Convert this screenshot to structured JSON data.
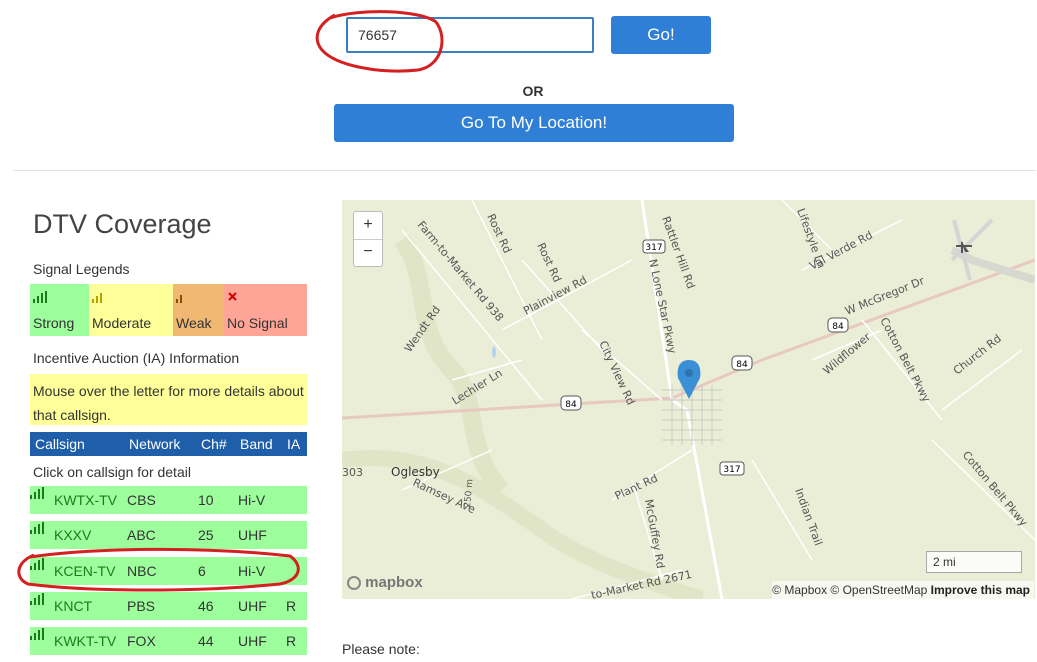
{
  "search": {
    "zip_value": "76657",
    "go_label": "Go!",
    "or_label": "OR",
    "locate_label": "Go To My Location!"
  },
  "panel": {
    "title": "DTV Coverage",
    "signal_legends_label": "Signal Legends",
    "legend": [
      {
        "label": "Strong",
        "color": "#9cff9c",
        "icon": "signal-strong-icon"
      },
      {
        "label": "Moderate",
        "color": "#ffff99",
        "icon": "signal-moderate-icon"
      },
      {
        "label": "Weak",
        "color": "#f0b873",
        "icon": "signal-weak-icon"
      },
      {
        "label": "No Signal",
        "color": "#ffa597",
        "icon": "no-signal-icon"
      }
    ],
    "ia_label": "Incentive Auction (IA) Information",
    "ia_text": "Mouse over the letter for more details about that callsign.",
    "table_headers": {
      "callsign": "Callsign",
      "network": "Network",
      "ch": "Ch#",
      "band": "Band",
      "ia": "IA"
    },
    "click_hint": "Click on callsign for detail",
    "rows": [
      {
        "callsign": "KWTX-TV",
        "network": "CBS",
        "ch": "10",
        "band": "Hi-V",
        "ia": ""
      },
      {
        "callsign": "KXXV",
        "network": "ABC",
        "ch": "25",
        "band": "UHF",
        "ia": ""
      },
      {
        "callsign": "KCEN-TV",
        "network": "NBC",
        "ch": "6",
        "band": "Hi-V",
        "ia": ""
      },
      {
        "callsign": "KNCT",
        "network": "PBS",
        "ch": "46",
        "band": "UHF",
        "ia": "R"
      },
      {
        "callsign": "KWKT-TV",
        "network": "FOX",
        "ch": "44",
        "band": "UHF",
        "ia": "R"
      }
    ]
  },
  "map": {
    "zoom_in": "+",
    "zoom_out": "−",
    "scale": "2 mi",
    "attribution": "© Mapbox © OpenStreetMap",
    "improve": "Improve this map",
    "logo": "mapbox",
    "labels": [
      "Rattler Hill Rd",
      "Lifestyle Ln",
      "Val Verde Rd",
      "Rost Rd",
      "Rost Rd",
      "Farm-to-Market Rd 938",
      "Plainview Rd",
      "N Lone Star Pkwy",
      "W McGregor Dr",
      "Wendt Rd",
      "City View Rd",
      "Wildflower",
      "Cotton Belt Pkwy",
      "Church Rd",
      "Lechler Ln",
      "303",
      "Oglesby",
      "Ramsey Ave",
      "250 m",
      "Plant Rd",
      "McGuffey Rd",
      "Indian Trail",
      "Cotton Belt Pkwy",
      "to-Market Rd 2671"
    ],
    "shields": [
      "317",
      "84",
      "84",
      "84",
      "317"
    ],
    "accent_water": "#b9d3e8",
    "marker_color": "#3b8fd4"
  },
  "note": "Please note:"
}
